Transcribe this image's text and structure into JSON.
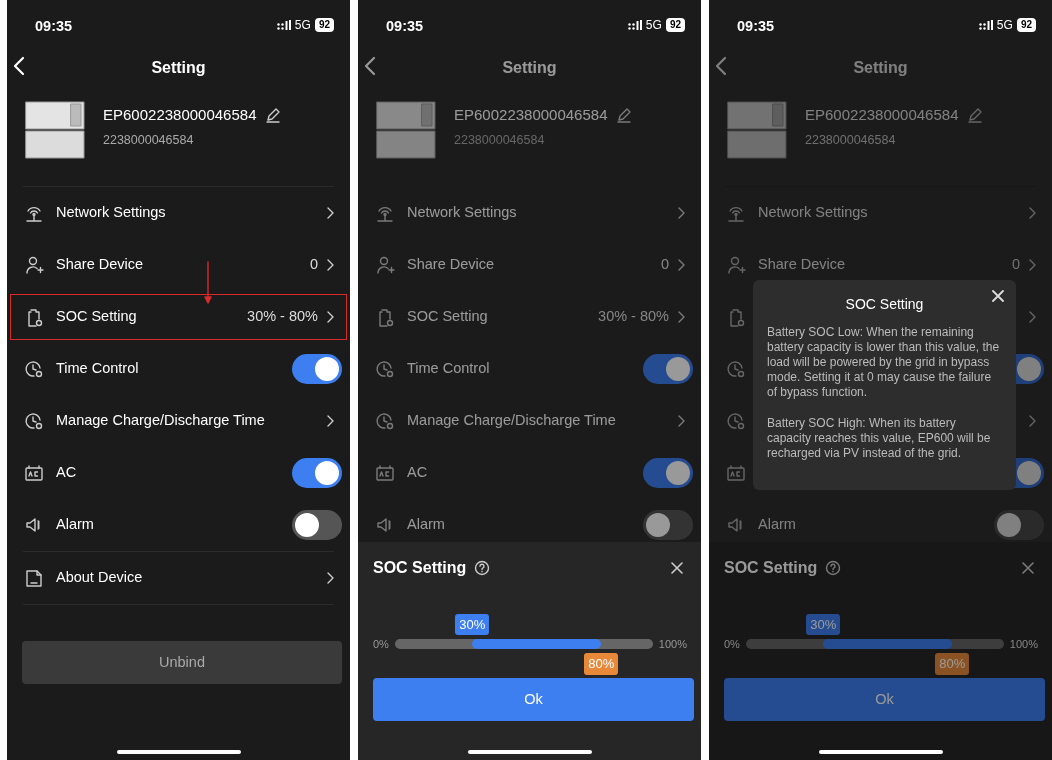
{
  "phones": [
    {
      "kind": "main",
      "status": {
        "time": "09:35",
        "network": "5G",
        "battery": "92"
      },
      "title": "Setting",
      "device": {
        "name": "EP6002238000046584",
        "serial": "2238000046584"
      },
      "rows": [
        {
          "label": "Network Settings",
          "kind": "chevron"
        },
        {
          "label": "Share Device",
          "value": "0",
          "kind": "chevron"
        },
        {
          "label": "SOC Setting",
          "value": "30% - 80%",
          "kind": "chevron",
          "highlighted": true
        },
        {
          "label": "Time Control",
          "kind": "toggle",
          "on": true
        },
        {
          "label": "Manage Charge/Discharge Time",
          "kind": "chevron"
        },
        {
          "label": "AC",
          "kind": "toggle",
          "on": true
        },
        {
          "label": "Alarm",
          "kind": "toggle",
          "on": false
        },
        {
          "label": "About Device",
          "kind": "chevron"
        }
      ],
      "unbind": "Unbind"
    },
    {
      "kind": "sheet",
      "status": {
        "time": "09:35",
        "network": "5G",
        "battery": "92"
      },
      "title": "Setting",
      "device": {
        "name": "EP6002238000046584",
        "serial": "2238000046584"
      },
      "rows": [
        {
          "label": "Network Settings",
          "kind": "chevron"
        },
        {
          "label": "Share Device",
          "value": "0",
          "kind": "chevron"
        },
        {
          "label": "SOC Setting",
          "value": "30% - 80%",
          "kind": "chevron"
        },
        {
          "label": "Time Control",
          "kind": "toggle",
          "on": true
        },
        {
          "label": "Manage Charge/Discharge Time",
          "kind": "chevron"
        },
        {
          "label": "AC",
          "kind": "toggle",
          "on": true
        },
        {
          "label": "Alarm",
          "kind": "toggle",
          "on": false
        }
      ],
      "sheet": {
        "title": "SOC Setting",
        "min_label": "0%",
        "max_label": "100%",
        "low": {
          "level": 0.3,
          "label": "30%"
        },
        "high": {
          "level": 0.8,
          "label": "80%"
        },
        "ok": "Ok"
      }
    },
    {
      "kind": "dialog",
      "status": {
        "time": "09:35",
        "network": "5G",
        "battery": "92"
      },
      "title": "Setting",
      "device": {
        "name": "EP6002238000046584",
        "serial": "2238000046584"
      },
      "rows": [
        {
          "label": "Network Settings",
          "kind": "chevron"
        },
        {
          "label": "Share Device",
          "value": "0",
          "kind": "chevron"
        },
        {
          "kind": "chevron"
        },
        {
          "kind": "toggle",
          "on": true
        },
        {
          "kind": "chevron"
        },
        {
          "kind": "toggle",
          "on": true
        },
        {
          "label": "Alarm",
          "kind": "toggle",
          "on": false
        }
      ],
      "sheet": {
        "title": "SOC Setting",
        "min_label": "0%",
        "max_label": "100%",
        "low": {
          "level": 0.3,
          "label": "30%"
        },
        "high": {
          "level": 0.8,
          "label": "80%"
        },
        "ok": "Ok"
      },
      "dialog": {
        "title": "SOC Setting",
        "paragraphs": [
          "Battery SOC Low: When the remaining battery capacity is lower than this value, the load will be powered by the grid in bypass mode. Setting it at 0 may cause the failure of bypass function.",
          "Battery SOC High: When its battery capacity reaches this value, EP600 will be recharged via PV instead of the grid."
        ]
      }
    }
  ]
}
